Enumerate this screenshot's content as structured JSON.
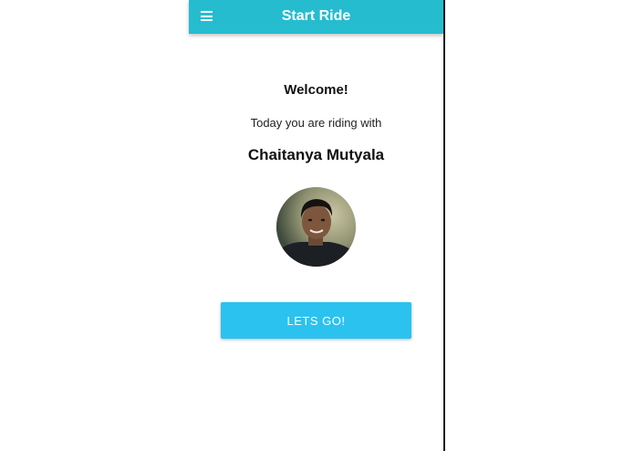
{
  "app_bar": {
    "title": "Start Ride",
    "menu_icon": "hamburger-menu-icon",
    "color": "#26bccf"
  },
  "main": {
    "welcome": "Welcome!",
    "subtitle": "Today you are riding with",
    "rider_name": "Chaitanya Mutyala",
    "avatar_icon": "rider-photo"
  },
  "actions": {
    "go_label": "LETS GO!",
    "go_color": "#2bc2ef"
  }
}
